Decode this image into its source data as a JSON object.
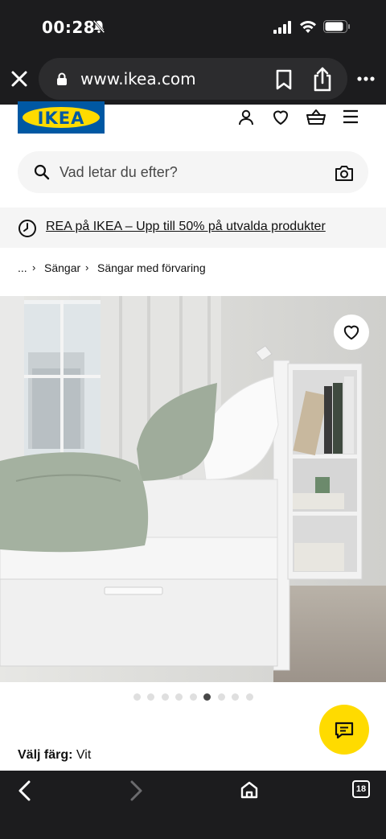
{
  "status": {
    "time": "00:28"
  },
  "browser": {
    "url": "www.ikea.com",
    "tabs_count": "18"
  },
  "header": {
    "logo_text": "IKEA"
  },
  "search": {
    "placeholder": "Vad letar du efter?"
  },
  "promo": {
    "text": "REA på IKEA – Upp till 50% på utvalda produkter"
  },
  "breadcrumb": {
    "ellipsis": "...",
    "items": [
      "Sängar",
      "Sängar med förvaring"
    ]
  },
  "carousel": {
    "total": 9,
    "active_index": 5
  },
  "product": {
    "color_label": "Välj färg:",
    "color_value": "Vit"
  },
  "colors": {
    "brand_blue": "#0058a3",
    "brand_yellow": "#ffdb00",
    "chrome_dark": "#1c1c1e"
  }
}
